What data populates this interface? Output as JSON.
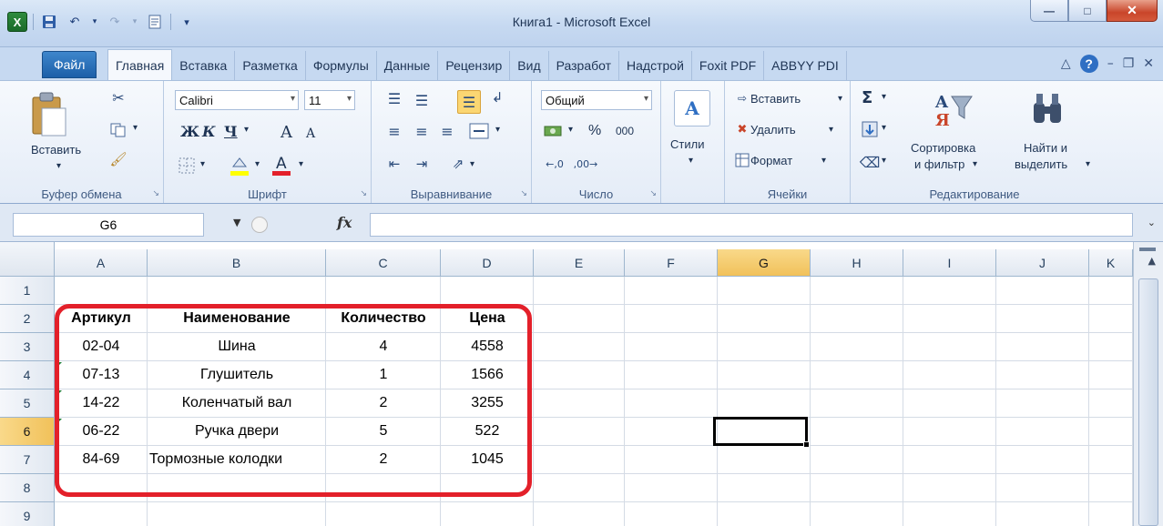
{
  "window": {
    "title": "Книга1  -  Microsoft Excel"
  },
  "qat": {
    "logo": "X"
  },
  "tabs": {
    "file": "Файл",
    "items": [
      "Главная",
      "Вставка",
      "Разметка",
      "Формулы",
      "Данные",
      "Рецензир",
      "Вид",
      "Разработ",
      "Надстрой",
      "Foxit PDF",
      "ABBYY PDI"
    ]
  },
  "ribbon": {
    "clipboard": {
      "paste": "Вставить",
      "label": "Буфер обмена"
    },
    "font": {
      "name": "Calibri",
      "size": "11",
      "bold": "Ж",
      "italic": "К",
      "underline": "Ч",
      "grow": "A",
      "shrink": "A",
      "label": "Шрифт"
    },
    "align": {
      "label": "Выравнивание"
    },
    "number": {
      "format": "Общий",
      "percent": "%",
      "thousands": "000",
      "label": "Число"
    },
    "styles": {
      "label": "Стили"
    },
    "cells": {
      "insert": "Вставить",
      "delete": "Удалить",
      "format": "Формат",
      "label": "Ячейки"
    },
    "editing": {
      "sum": "Σ",
      "sort1": "Сортировка",
      "sort2": "и фильтр",
      "find1": "Найти и",
      "find2": "выделить",
      "label": "Редактирование"
    }
  },
  "formula_bar": {
    "name_box": "G6",
    "fx": "fx",
    "value": ""
  },
  "sheet": {
    "columns": [
      "A",
      "B",
      "C",
      "D",
      "E",
      "F",
      "G",
      "H",
      "I",
      "J",
      "K"
    ],
    "rows": [
      "1",
      "2",
      "3",
      "4",
      "5",
      "6",
      "7",
      "8",
      "9"
    ],
    "selected_col": "G",
    "selected_row": "6",
    "header_row": [
      "Артикул",
      "Наименование",
      "Количество",
      "Цена"
    ],
    "data": [
      [
        "02-04",
        "Шина",
        "4",
        "4558"
      ],
      [
        "07-13",
        "Глушитель",
        "1",
        "1566"
      ],
      [
        "14-22",
        "Коленчатый вал",
        "2",
        "3255"
      ],
      [
        "06-22",
        "Ручка двери",
        "5",
        "522"
      ],
      [
        "84-69",
        "Тормозные колодки",
        "2",
        "1045"
      ]
    ]
  },
  "colors": {
    "highlight": "#e3202a",
    "excel_green": "#1e7b34",
    "ribbon_blue": "#c6d9f1"
  }
}
